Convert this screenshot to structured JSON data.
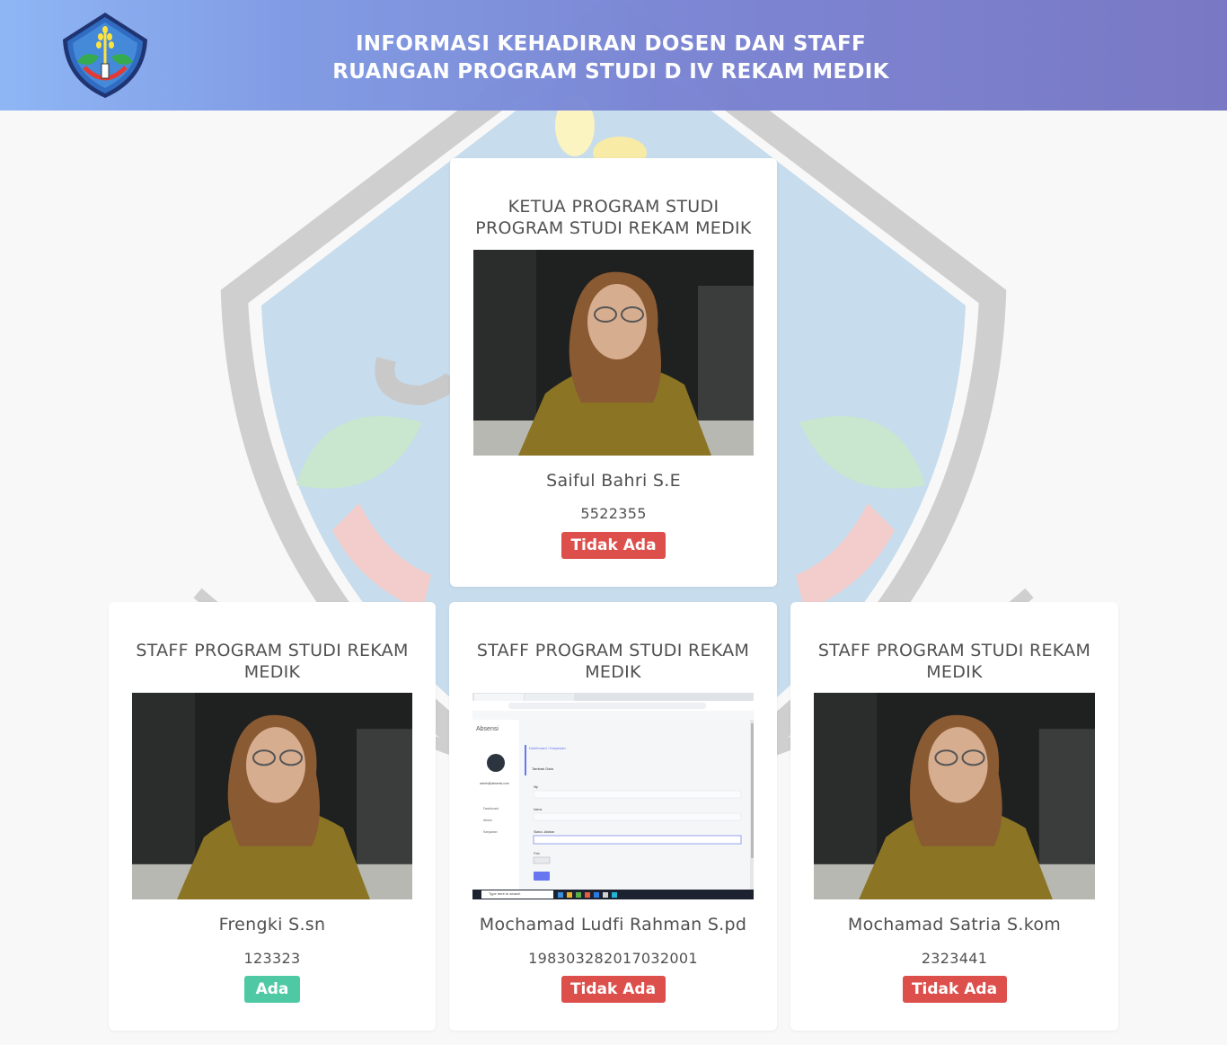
{
  "header": {
    "title_line1": "INFORMASI KEHADIRAN DOSEN DAN STAFF",
    "title_line2": "RUANGAN PROGRAM STUDI D IV REKAM MEDIK",
    "logo": "polije-emblem-icon"
  },
  "head_card": {
    "title": "KETUA PROGRAM STUDI PROGRAM STUDI REKAM MEDIK",
    "name": "Saiful Bahri S.E",
    "id": "5522355",
    "status": "Tidak Ada"
  },
  "staff_cards": [
    {
      "title": "STAFF PROGRAM STUDI REKAM MEDIK",
      "name": "Frengki S.sn",
      "id": "123323",
      "status": "Ada"
    },
    {
      "title": "STAFF PROGRAM STUDI REKAM MEDIK",
      "name": "Mochamad Ludfi Rahman S.pd",
      "id": "198303282017032001",
      "status": "Tidak Ada"
    },
    {
      "title": "STAFF PROGRAM STUDI REKAM MEDIK",
      "name": "Mochamad Satria S.kom",
      "id": "2323441",
      "status": "Tidak Ada"
    }
  ],
  "screenshot_photo": {
    "app_title": "Absensi",
    "breadcrumb": "Dashboard / Karyawan",
    "section": "Tambah Data",
    "email": "admin@absensi.com",
    "menu": [
      "Dashboard",
      "Absen",
      "Karyawan"
    ],
    "fields": [
      "Nip",
      "Nama",
      "Status Jabatan",
      "Foto"
    ],
    "taskbar_search": "Type here to search"
  },
  "colors": {
    "header_start": "#8bb4f5",
    "header_end": "#7574c3",
    "absent": "#dc4f4b",
    "present": "#4fc9a4",
    "text": "#505050"
  }
}
